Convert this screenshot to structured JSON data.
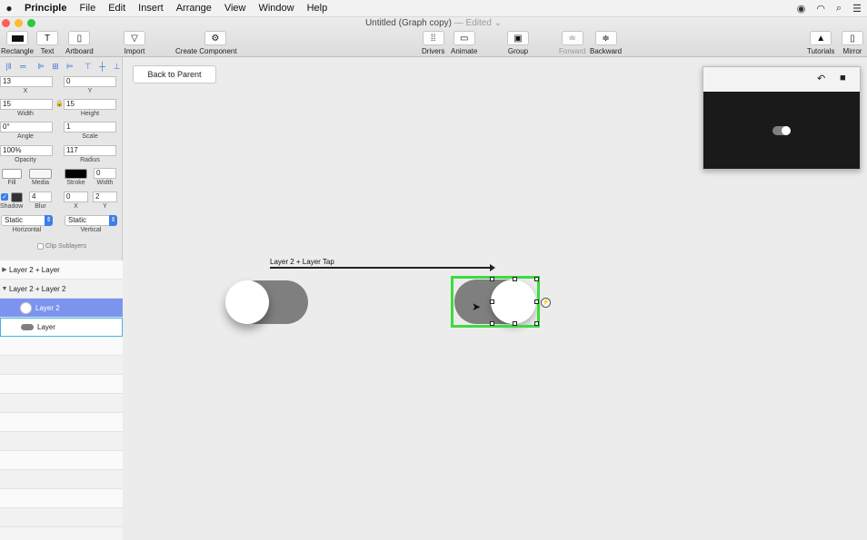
{
  "menubar": {
    "app": "Principle",
    "items": [
      "File",
      "Edit",
      "Insert",
      "Arrange",
      "View",
      "Window",
      "Help"
    ]
  },
  "window": {
    "title": "Untitled (Graph copy)",
    "edited": "— Edited ⌄"
  },
  "toolbar": {
    "rectangle": "Rectangle",
    "text": "Text",
    "artboard": "Artboard",
    "import": "Import",
    "create_component": "Create Component",
    "drivers": "Drivers",
    "animate": "Animate",
    "group": "Group",
    "forward": "Forward",
    "backward": "Backward",
    "tutorials": "Tutorials",
    "mirror": "Mirror"
  },
  "inspector": {
    "x": "13",
    "x_label": "X",
    "y": "0",
    "y_label": "Y",
    "width": "15",
    "width_label": "Width",
    "height": "15",
    "height_label": "Height",
    "angle": "0°",
    "angle_label": "Angle",
    "scale": "1",
    "scale_label": "Scale",
    "opacity": "100%",
    "opacity_label": "Opacity",
    "radius": "117",
    "radius_label": "Radius",
    "fill_label": "Fill",
    "media_label": "Media",
    "stroke_label": "Stroke",
    "stroke_width": "0",
    "stroke_width_label": "Width",
    "shadow_label": "Shadow",
    "blur": "4",
    "blur_label": "Blur",
    "shadow_x": "0",
    "shadow_x_label": "X",
    "shadow_y": "2",
    "shadow_y_label": "Y",
    "horizontal": "Static",
    "horizontal_label": "Horizontal",
    "vertical": "Static",
    "vertical_label": "Vertical",
    "clip_sublayers": "Clip Sublayers",
    "stroke_color": "#000000"
  },
  "layers": {
    "items": [
      {
        "label": "Layer 2 + Layer",
        "expanded": false
      },
      {
        "label": "Layer 2 + Layer 2",
        "expanded": true
      },
      {
        "label": "Layer 2"
      },
      {
        "label": "Layer"
      }
    ]
  },
  "canvas": {
    "back_to_parent": "Back to Parent",
    "interaction_label": "Layer 2 + Layer Tap",
    "track_color": "#7f7f7f",
    "selection_color": "#3ddb3d"
  },
  "preview": {
    "undo_icon": "↶",
    "record_icon": "■"
  }
}
